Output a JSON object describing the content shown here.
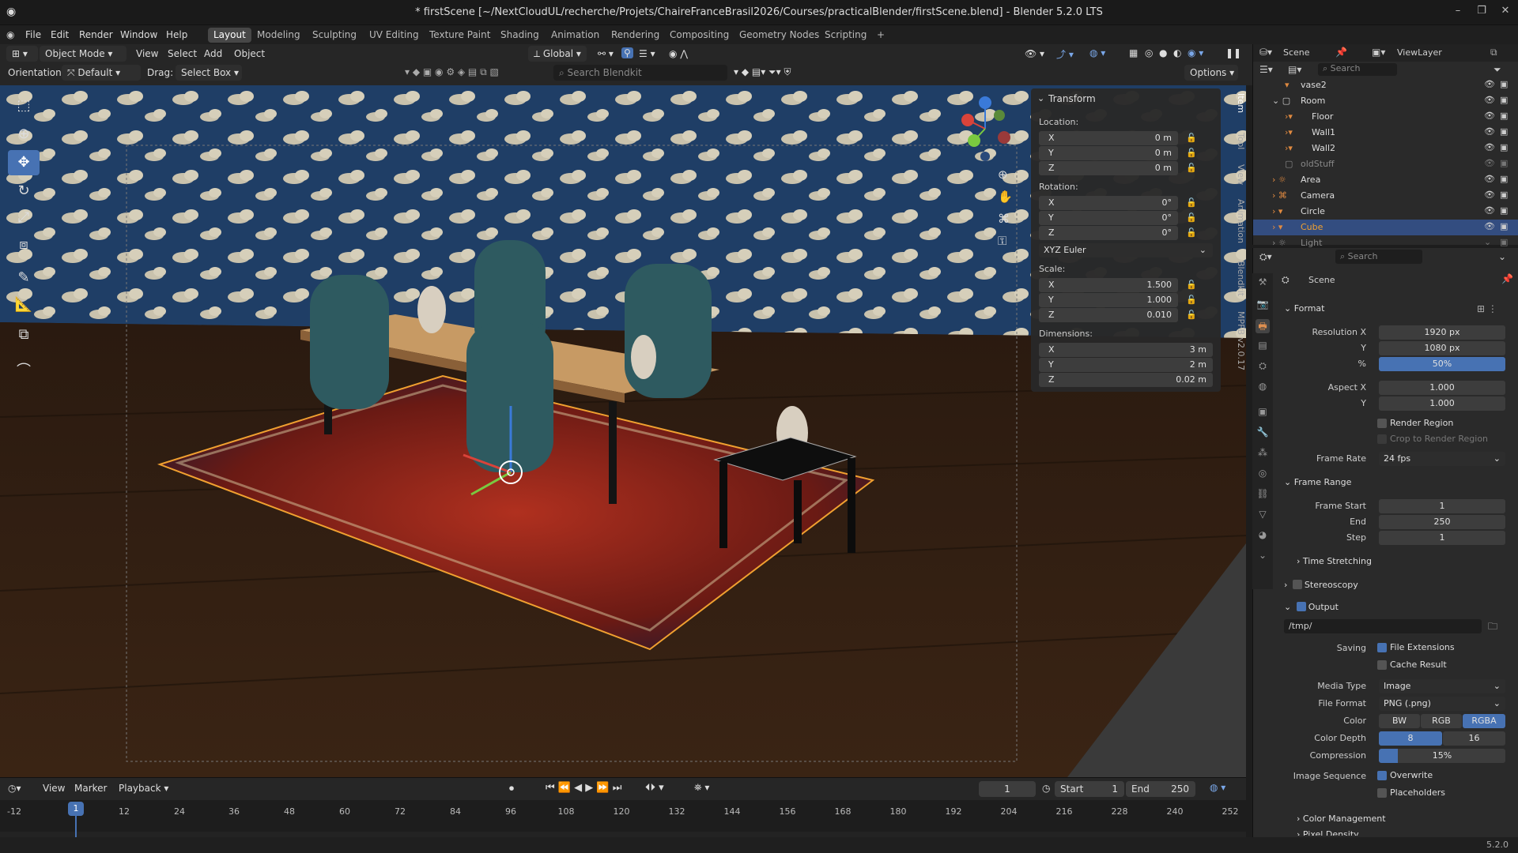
{
  "title": "* firstScene [~/NextCloudUL/recherche/Projets/ChaireFranceBrasil2026/Courses/practicalBlender/firstScene.blend] - Blender 5.2.0 LTS",
  "menu": [
    "File",
    "Edit",
    "Render",
    "Window",
    "Help"
  ],
  "workspaces": [
    "Layout",
    "Modeling",
    "Sculpting",
    "UV Editing",
    "Texture Paint",
    "Shading",
    "Animation",
    "Rendering",
    "Compositing",
    "Geometry Nodes",
    "Scripting",
    "+"
  ],
  "header": {
    "mode": "Object Mode",
    "view": "View",
    "select": "Select",
    "add": "Add",
    "object": "Object",
    "orientation_label": "Orientation:",
    "orientation": "Default",
    "drag_label": "Drag:",
    "drag": "Select Box",
    "transform_space": "Global",
    "search_placeholder": "Search Blendkit",
    "options": "Options"
  },
  "npanel": {
    "title": "Transform",
    "location": "Location:",
    "rotation": "Rotation:",
    "scale": "Scale:",
    "dimensions": "Dimensions:",
    "euler": "XYZ Euler",
    "loc": [
      [
        "X",
        "0 m"
      ],
      [
        "Y",
        "0 m"
      ],
      [
        "Z",
        "0 m"
      ]
    ],
    "rot": [
      [
        "X",
        "0°"
      ],
      [
        "Y",
        "0°"
      ],
      [
        "Z",
        "0°"
      ]
    ],
    "scl": [
      [
        "X",
        "1.500"
      ],
      [
        "Y",
        "1.000"
      ],
      [
        "Z",
        "0.010"
      ]
    ],
    "dim": [
      [
        "X",
        "3 m"
      ],
      [
        "Y",
        "2 m"
      ],
      [
        "Z",
        "0.02 m"
      ]
    ]
  },
  "vtabs": [
    "Item",
    "Tool",
    "View",
    "Animation",
    "Blendkit",
    "MPFB v2.0.17"
  ],
  "outliner": {
    "scene": "Scene",
    "viewlayer": "ViewLayer",
    "search": "Search",
    "rows": [
      "vase2",
      "Room",
      "Floor",
      "Wall1",
      "Wall2",
      "oldStuff",
      "Area",
      "Camera",
      "Circle",
      "Cube",
      "Light"
    ]
  },
  "props": {
    "search": "Search",
    "scene": "Scene",
    "format": "Format",
    "res_x_label": "Resolution X",
    "res_x": "1920 px",
    "y_label": "Y",
    "res_y": "1080 px",
    "pct_label": "%",
    "pct": "50%",
    "aspect_x_label": "Aspect X",
    "aspect_x": "1.000",
    "aspect_y": "1.000",
    "render_region": "Render Region",
    "crop": "Crop to Render Region",
    "frame_rate_label": "Frame Rate",
    "frame_rate": "24 fps",
    "frame_range": "Frame Range",
    "frame_start_label": "Frame Start",
    "frame_start": "1",
    "end_label": "End",
    "end": "250",
    "step_label": "Step",
    "step": "1",
    "time_stretching": "Time Stretching",
    "stereoscopy": "Stereoscopy",
    "output": "Output",
    "path": "/tmp/",
    "saving_label": "Saving",
    "file_ext": "File Extensions",
    "cache": "Cache Result",
    "media_type_label": "Media Type",
    "media_type": "Image",
    "file_format_label": "File Format",
    "file_format": "PNG (.png)",
    "color_label": "Color",
    "bw": "BW",
    "rgb": "RGB",
    "rgba": "RGBA",
    "depth_label": "Color Depth",
    "d8": "8",
    "d16": "16",
    "compression_label": "Compression",
    "compression": "15%",
    "compression_value": 0.15,
    "seq_label": "Image Sequence",
    "overwrite": "Overwrite",
    "placeholders": "Placeholders",
    "color_mgmt": "Color Management",
    "pixel_density": "Pixel Density"
  },
  "timeline": {
    "view": "View",
    "marker": "Marker",
    "playback": "Playback",
    "current": "1",
    "start_label": "Start",
    "start": "1",
    "end_label": "End",
    "end": "250",
    "ticks": [
      "-12",
      "1",
      "12",
      "24",
      "36",
      "48",
      "60",
      "72",
      "84",
      "96",
      "108",
      "120",
      "132",
      "144",
      "156",
      "168",
      "180",
      "192",
      "204",
      "216",
      "228",
      "240",
      "252"
    ]
  },
  "status": {
    "version": "5.2.0"
  }
}
